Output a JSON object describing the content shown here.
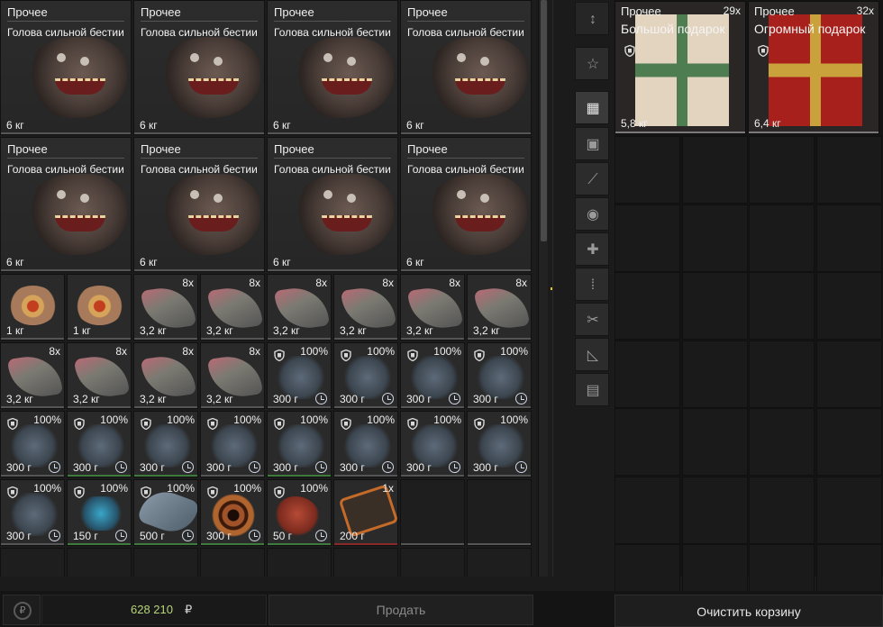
{
  "inventory": {
    "big_items": [
      {
        "category": "Прочее",
        "name": "Голова сильной бестии",
        "weight": "6 кг"
      },
      {
        "category": "Прочее",
        "name": "Голова сильной бестии",
        "weight": "6 кг"
      },
      {
        "category": "Прочее",
        "name": "Голова сильной бестии",
        "weight": "6 кг"
      },
      {
        "category": "Прочее",
        "name": "Голова сильной бестии",
        "weight": "6 кг"
      },
      {
        "category": "Прочее",
        "name": "Голова сильной бестии",
        "weight": "6 кг"
      },
      {
        "category": "Прочее",
        "name": "Голова сильной бестии",
        "weight": "6 кг"
      },
      {
        "category": "Прочее",
        "name": "Голова сильной бестии",
        "weight": "6 кг"
      },
      {
        "category": "Прочее",
        "name": "Голова сильной бестии",
        "weight": "6 кг"
      }
    ],
    "small_items": [
      {
        "art": "eyeball",
        "weight": "1 кг",
        "qty": "",
        "pct": ""
      },
      {
        "art": "eyeball",
        "weight": "1 кг",
        "qty": "",
        "pct": ""
      },
      {
        "art": "horn",
        "weight": "3,2 кг",
        "qty": "8x",
        "pct": ""
      },
      {
        "art": "horn",
        "weight": "3,2 кг",
        "qty": "8x",
        "pct": ""
      },
      {
        "art": "horn",
        "weight": "3,2 кг",
        "qty": "8x",
        "pct": ""
      },
      {
        "art": "horn",
        "weight": "3,2 кг",
        "qty": "8x",
        "pct": ""
      },
      {
        "art": "horn",
        "weight": "3,2 кг",
        "qty": "8x",
        "pct": ""
      },
      {
        "art": "horn",
        "weight": "3,2 кг",
        "qty": "8x",
        "pct": ""
      },
      {
        "art": "horn",
        "weight": "3,2 кг",
        "qty": "8x",
        "pct": ""
      },
      {
        "art": "horn",
        "weight": "3,2 кг",
        "qty": "8x",
        "pct": ""
      },
      {
        "art": "horn",
        "weight": "3,2 кг",
        "qty": "8x",
        "pct": ""
      },
      {
        "art": "horn",
        "weight": "3,2 кг",
        "qty": "8x",
        "pct": ""
      },
      {
        "art": "fluff",
        "weight": "300 г",
        "qty": "",
        "pct": "100%"
      },
      {
        "art": "fluff",
        "weight": "300 г",
        "qty": "",
        "pct": "100%"
      },
      {
        "art": "fluff",
        "weight": "300 г",
        "qty": "",
        "pct": "100%"
      },
      {
        "art": "fluff",
        "weight": "300 г",
        "qty": "",
        "pct": "100%"
      },
      {
        "art": "fluff",
        "weight": "300 г",
        "qty": "",
        "pct": "100%"
      },
      {
        "art": "fluff",
        "weight": "300 г",
        "qty": "",
        "pct": "100%"
      },
      {
        "art": "fluff",
        "weight": "300 г",
        "qty": "",
        "pct": "100%"
      },
      {
        "art": "fluff",
        "weight": "300 г",
        "qty": "",
        "pct": "100%"
      },
      {
        "art": "fluff",
        "weight": "300 г",
        "qty": "",
        "pct": "100%"
      },
      {
        "art": "fluff",
        "weight": "300 г",
        "qty": "",
        "pct": "100%"
      },
      {
        "art": "fluff",
        "weight": "300 г",
        "qty": "",
        "pct": "100%"
      },
      {
        "art": "fluff",
        "weight": "300 г",
        "qty": "",
        "pct": "100%"
      },
      {
        "art": "fluff",
        "weight": "300 г",
        "qty": "",
        "pct": "100%"
      },
      {
        "art": "fluffblue",
        "weight": "150 г",
        "qty": "",
        "pct": "100%"
      },
      {
        "art": "tentacle",
        "weight": "500 г",
        "qty": "",
        "pct": "100%"
      },
      {
        "art": "coil",
        "weight": "300 г",
        "qty": "",
        "pct": "100%"
      },
      {
        "art": "meat",
        "weight": "50 г",
        "qty": "",
        "pct": "100%"
      },
      {
        "art": "device",
        "weight": "200 г",
        "qty": "1x",
        "pct": ""
      }
    ]
  },
  "filters": [
    {
      "icon": "sort-icon",
      "glyph": "↕"
    },
    {
      "icon": "star-icon",
      "glyph": "☆"
    },
    {
      "icon": "grid-icon",
      "glyph": "▦"
    },
    {
      "icon": "backpack-icon",
      "glyph": "▣"
    },
    {
      "icon": "weapon-icon",
      "glyph": "⟋"
    },
    {
      "icon": "artifact-icon",
      "glyph": "◉"
    },
    {
      "icon": "medkit-icon",
      "glyph": "✚"
    },
    {
      "icon": "ammo-icon",
      "glyph": "⁞"
    },
    {
      "icon": "tools-icon",
      "glyph": "✂"
    },
    {
      "icon": "blueprint-icon",
      "glyph": "◺"
    },
    {
      "icon": "box-icon",
      "glyph": "▤"
    }
  ],
  "basket": {
    "items": [
      {
        "category": "Прочее",
        "qty": "29x",
        "name": "Большой подарок",
        "weight": "5,8 кг",
        "color": "#e3d4bf",
        "ribbon": "#4f7d52"
      },
      {
        "category": "Прочее",
        "qty": "32x",
        "name": "Огромный подарок",
        "weight": "6,4 кг",
        "color": "#a8201c",
        "ribbon": "#c9a23b"
      }
    ],
    "clear_label": "Очистить корзину"
  },
  "footer": {
    "money": "628 210",
    "currency": "₽",
    "sell_label": "Продать",
    "currency_icon": "₽"
  },
  "colors": {
    "money": "#b7d57a",
    "accent_green": "#3e7a3c",
    "accent_red": "#8a2a28",
    "selected_dot": "#e8c21e"
  }
}
